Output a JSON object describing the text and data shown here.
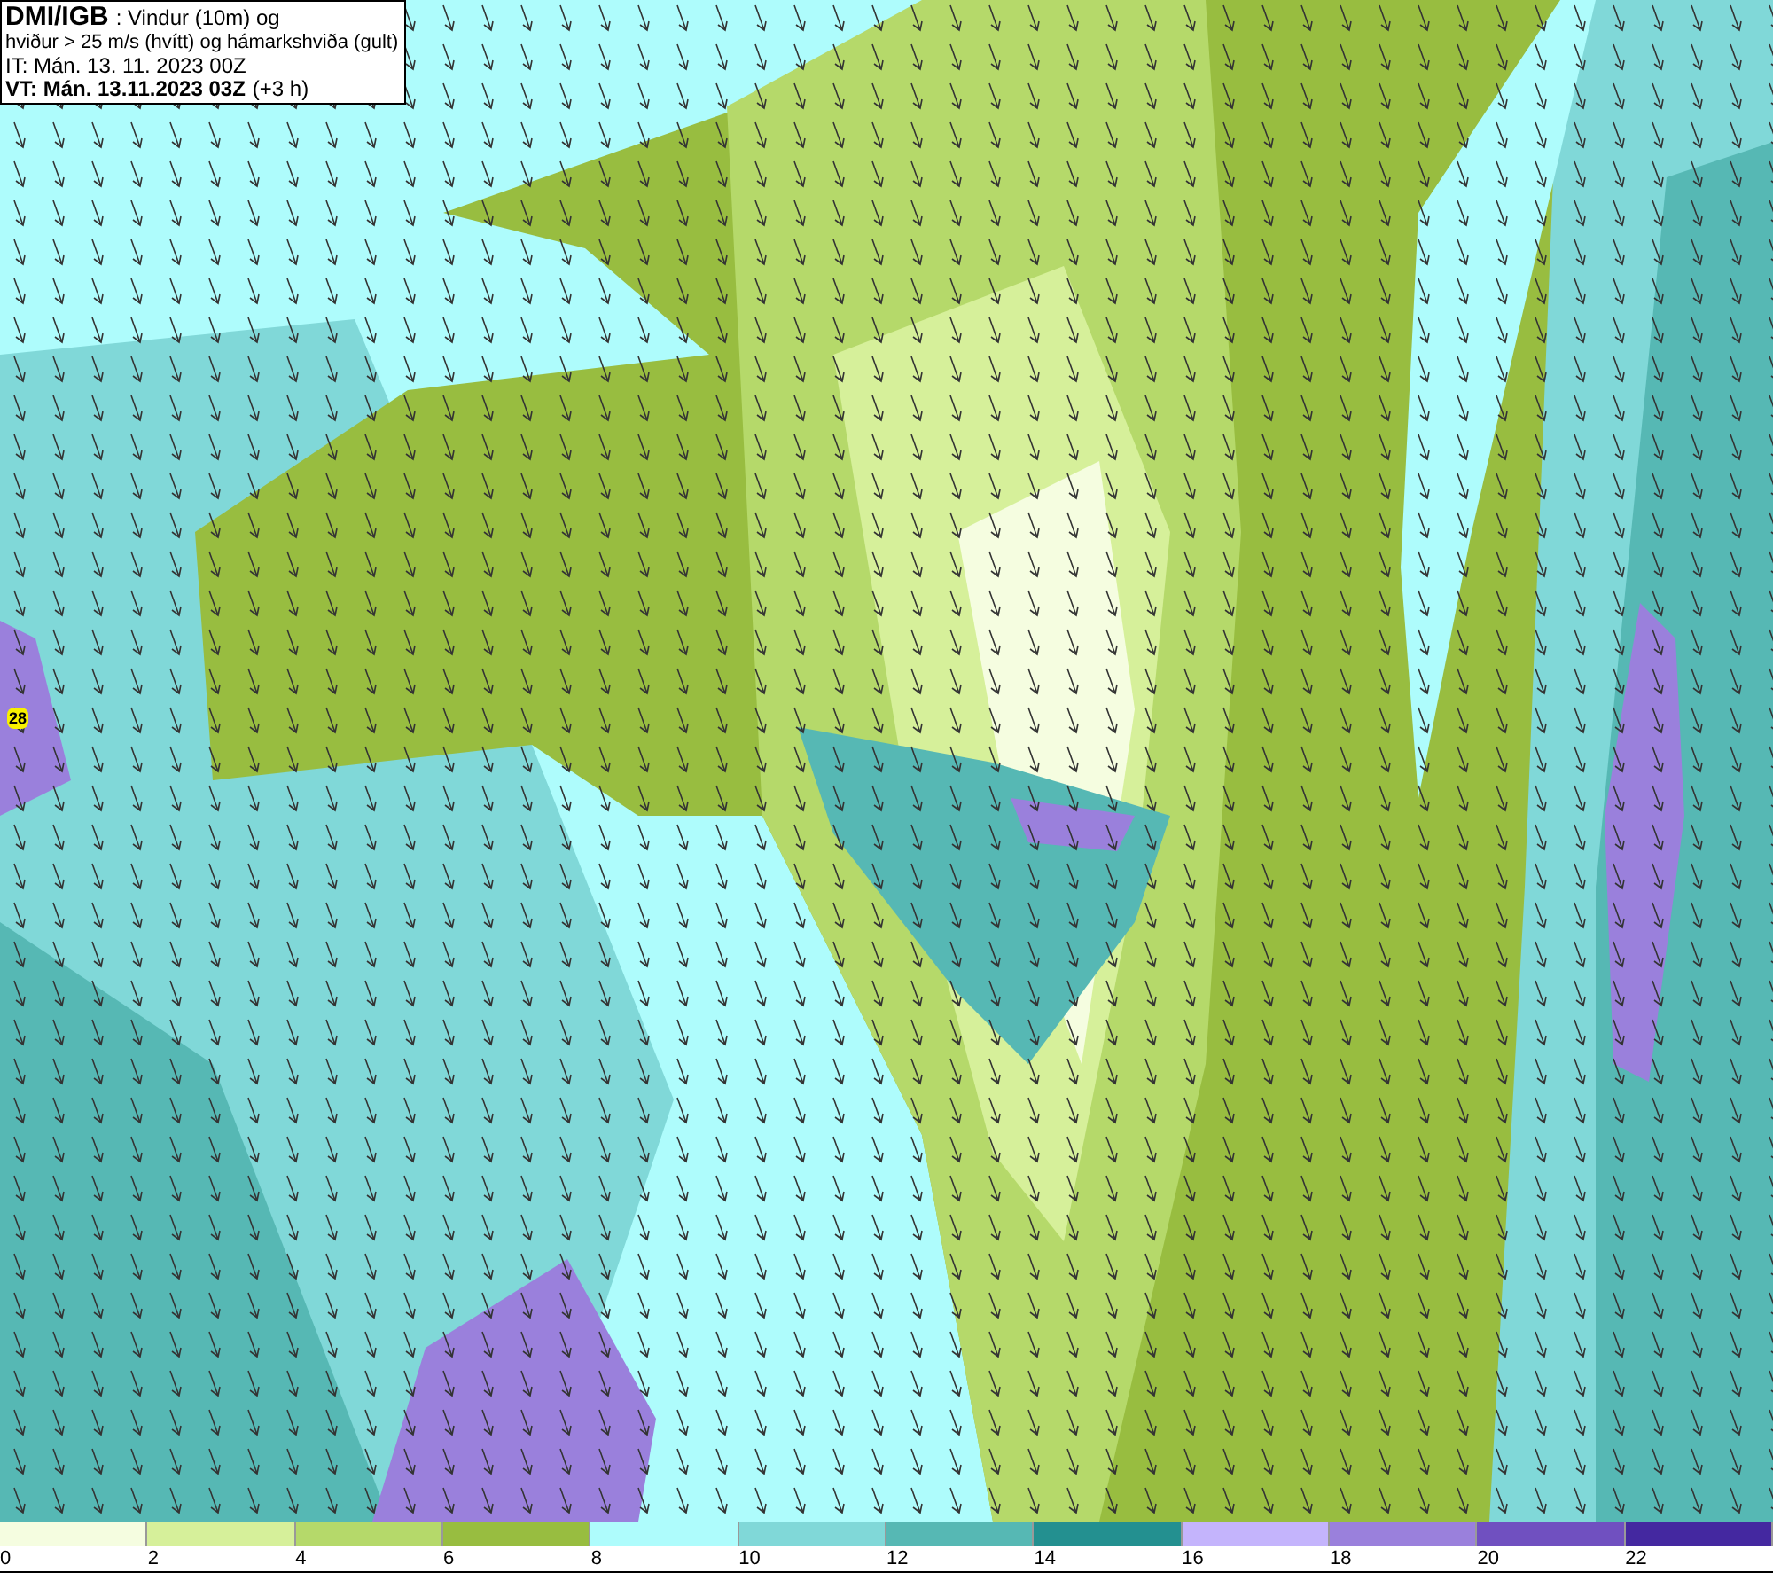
{
  "header": {
    "source": "DMI/IGB",
    "title": ": Vindur (10m) og",
    "line_2": "hviður > 25 m/s (hvítt) og hámarkshviða (gult)",
    "init_time": "IT: Mán. 13. 11. 2023 00Z",
    "valid_time": "VT: Mán. 13.11.2023 03Z",
    "valid_offset": "(+3 h)"
  },
  "map": {
    "gust_label": "28"
  },
  "legend": [
    {
      "label": "0",
      "color": "#f5fde0"
    },
    {
      "label": "2",
      "color": "#d6f09a"
    },
    {
      "label": "4",
      "color": "#b5d96a"
    },
    {
      "label": "6",
      "color": "#98bd40"
    },
    {
      "label": "8",
      "color": "#aefcfc"
    },
    {
      "label": "10",
      "color": "#80d8d8"
    },
    {
      "label": "12",
      "color": "#56b8b4"
    },
    {
      "label": "14",
      "color": "#239090"
    },
    {
      "label": "16",
      "color": "#c4b4fc"
    },
    {
      "label": "18",
      "color": "#9a80dc"
    },
    {
      "label": "20",
      "color": "#7050c0"
    },
    {
      "label": "22",
      "color": "#4428a0"
    }
  ]
}
